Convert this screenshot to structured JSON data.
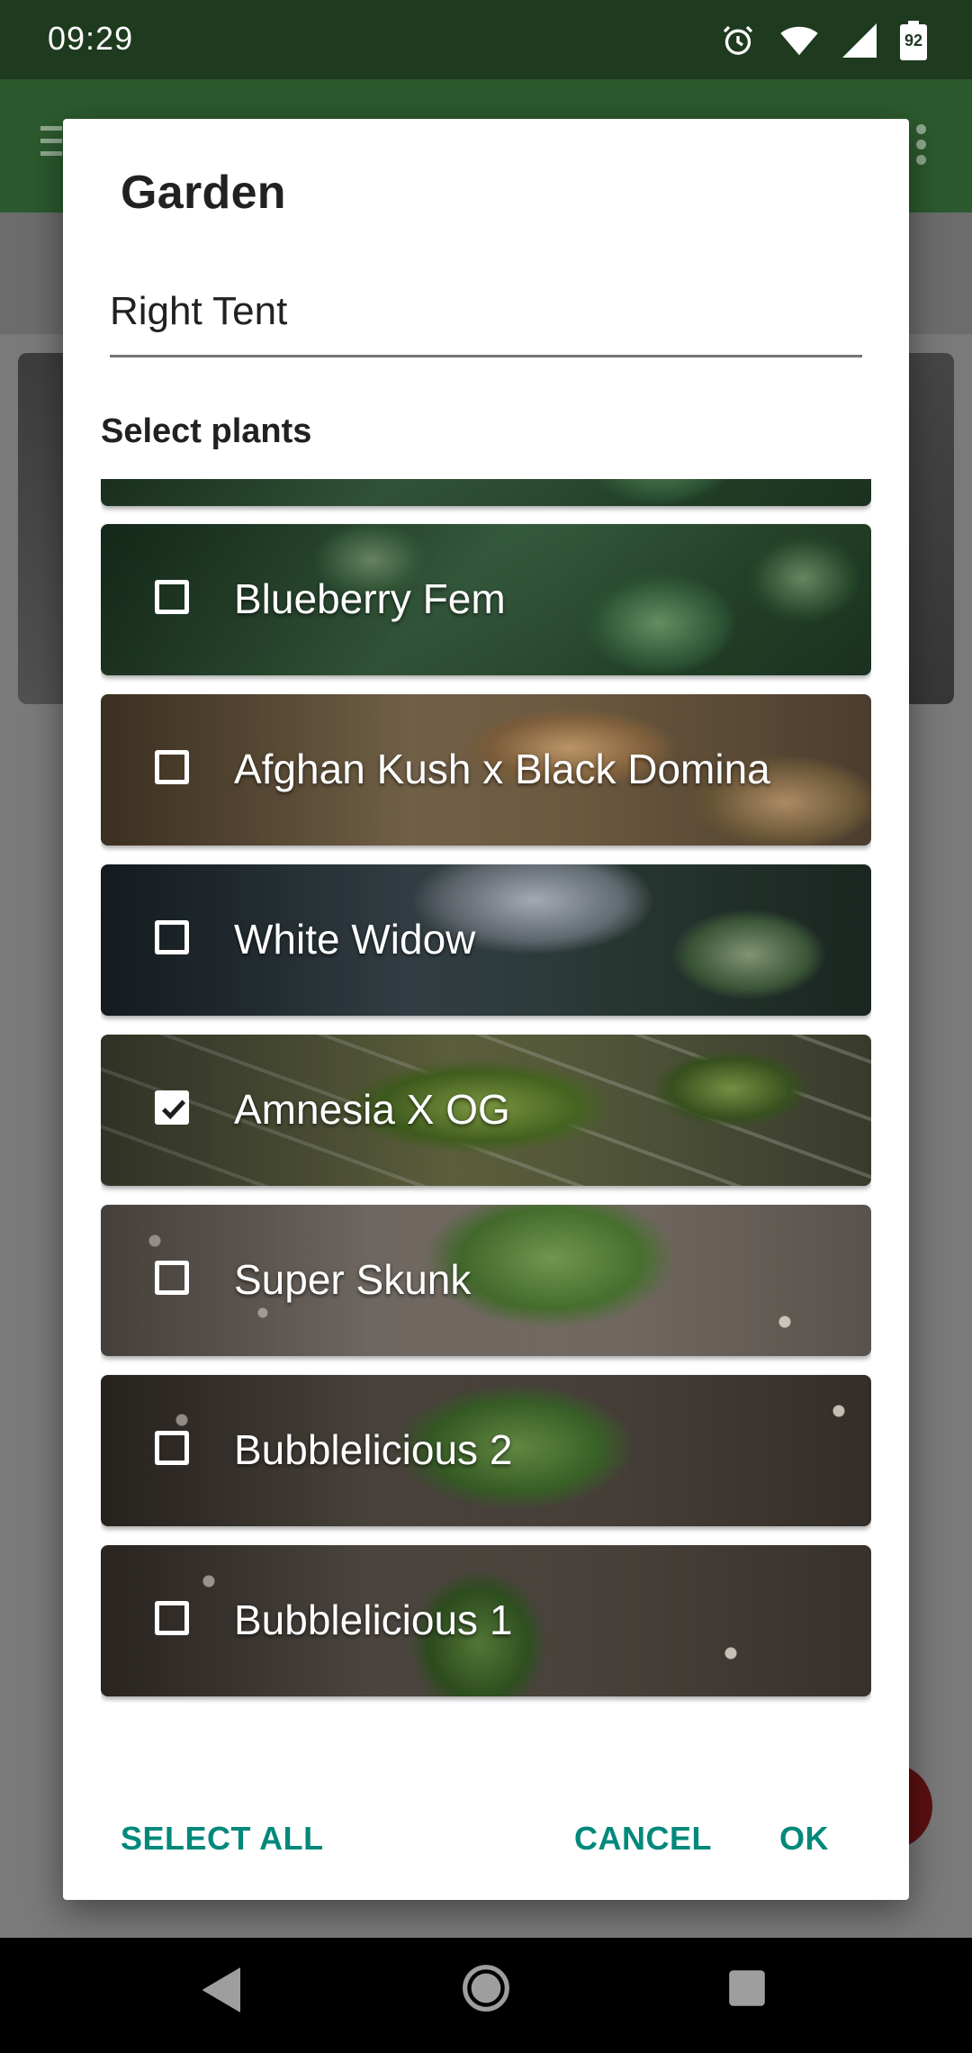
{
  "status_bar": {
    "time": "09:29",
    "battery_level": "92",
    "icons": [
      "alarm-icon",
      "wifi-icon",
      "signal-icon",
      "battery-icon"
    ]
  },
  "app_bar": {
    "icons": [
      "menu-icon",
      "more-options-icon"
    ]
  },
  "dialog": {
    "title": "Garden",
    "name_field": {
      "value": "Right Tent"
    },
    "section_label": "Select plants",
    "plants": [
      {
        "name": "Blueberry Fem",
        "checked": false
      },
      {
        "name": "Afghan Kush x Black Domina",
        "checked": false
      },
      {
        "name": "White Widow",
        "checked": false
      },
      {
        "name": "Amnesia X OG",
        "checked": true
      },
      {
        "name": "Super Skunk",
        "checked": false
      },
      {
        "name": "Bubblelicious 2",
        "checked": false
      },
      {
        "name": "Bubblelicious 1",
        "checked": false
      }
    ],
    "actions": {
      "select_all": "SELECT ALL",
      "cancel": "CANCEL",
      "ok": "OK"
    }
  },
  "nav_bar": {
    "icons": [
      "back-icon",
      "home-icon",
      "recents-icon"
    ]
  },
  "colors": {
    "status_bar": "#1e3a1f",
    "app_bar": "#2c5a2e",
    "accent": "#00897b",
    "fab": "#5c1010"
  }
}
